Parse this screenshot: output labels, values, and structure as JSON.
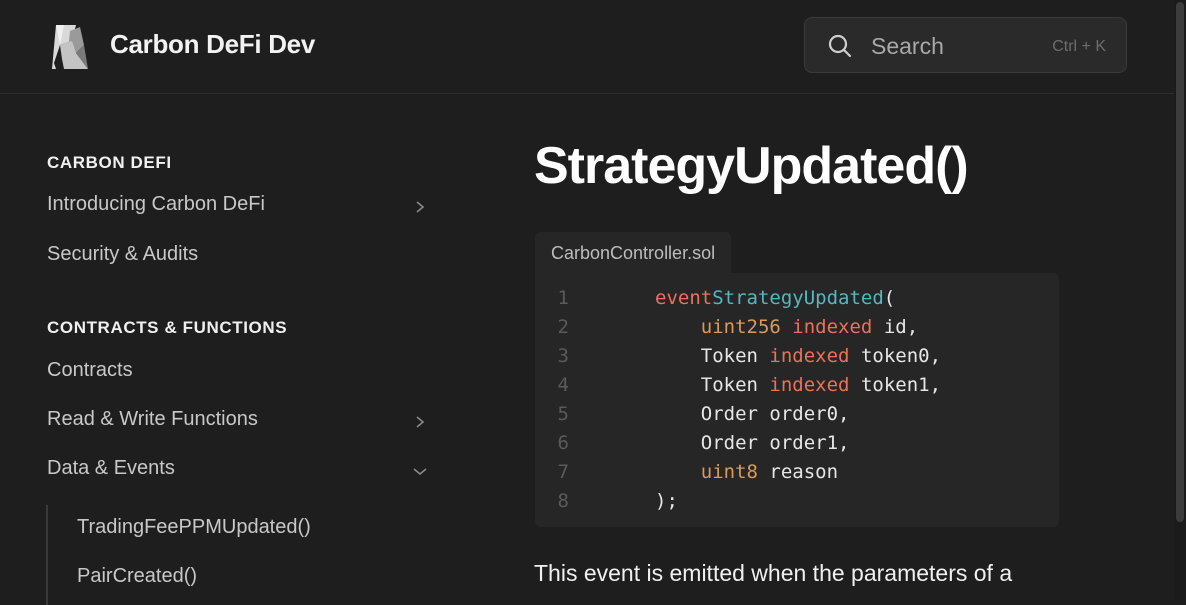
{
  "header": {
    "site_title": "Carbon DeFi Dev",
    "search_label": "Search",
    "search_shortcut": "Ctrl + K"
  },
  "sidebar": {
    "section1_title": "CARBON DEFI",
    "section1_items": [
      {
        "label": "Introducing Carbon DeFi",
        "chevron": "chevron-right-icon"
      },
      {
        "label": "Security & Audits"
      }
    ],
    "section2_title": "CONTRACTS & FUNCTIONS",
    "section2_items": [
      {
        "label": "Contracts"
      },
      {
        "label": "Read & Write Functions",
        "chevron": "chevron-right-icon"
      },
      {
        "label": "Data & Events",
        "chevron": "chevron-down-icon"
      }
    ],
    "sub_items": [
      "TradingFeePPMUpdated()",
      "PairCreated()"
    ]
  },
  "main": {
    "page_title": "StrategyUpdated()",
    "code_file": "CarbonController.sol",
    "code_lines": [
      {
        "n": "1",
        "parts": [
          [
            "kw",
            "event"
          ],
          [
            "",
            ""
          ],
          [
            "fn",
            "StrategyUpdated"
          ],
          [
            "",
            "("
          ]
        ]
      },
      {
        "n": "2",
        "parts": [
          [
            "ty",
            "uint256"
          ],
          [
            "kw",
            "indexed"
          ],
          [
            "",
            "id,"
          ]
        ]
      },
      {
        "n": "3",
        "parts": [
          [
            "",
            "Token"
          ],
          [
            "kw",
            "indexed"
          ],
          [
            "",
            "token0,"
          ]
        ]
      },
      {
        "n": "4",
        "parts": [
          [
            "",
            "Token"
          ],
          [
            "kw",
            "indexed"
          ],
          [
            "",
            "token1,"
          ]
        ]
      },
      {
        "n": "5",
        "parts": [
          [
            "",
            "Order"
          ],
          [
            "",
            "order0,"
          ]
        ]
      },
      {
        "n": "6",
        "parts": [
          [
            "",
            "Order"
          ],
          [
            "",
            "order1,"
          ]
        ]
      },
      {
        "n": "7",
        "parts": [
          [
            "ty",
            "uint8"
          ],
          [
            "",
            "reason"
          ]
        ]
      },
      {
        "n": "8",
        "parts": [
          [
            "",
            ");"
          ]
        ]
      }
    ],
    "body_text": "This event is emitted when the parameters of a"
  },
  "colors": {
    "background": "#1e1e1e",
    "keyword": "#e8735a",
    "function": "#56b6c2",
    "type": "#d99a5e"
  }
}
